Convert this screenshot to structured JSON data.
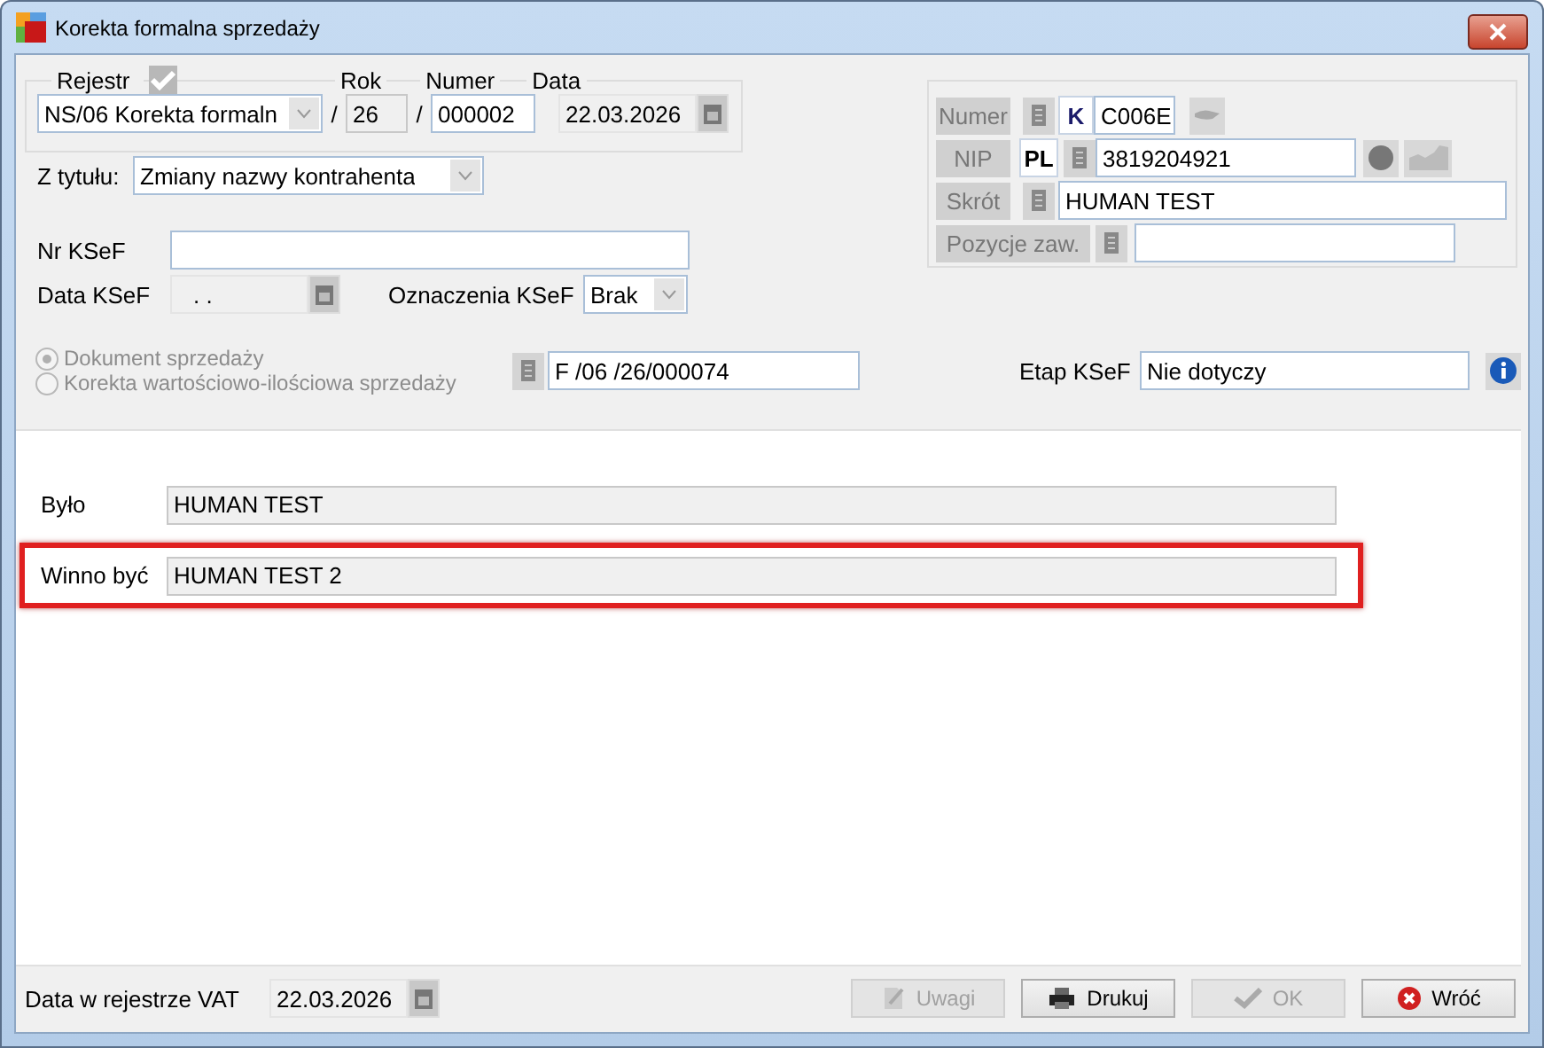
{
  "window": {
    "title": "Korekta formalna sprzedaży"
  },
  "header": {
    "rejestr": {
      "label": "Rejestr",
      "checked": true,
      "value": "NS/06 Korekta formaln"
    },
    "separator": "/",
    "rok": {
      "label": "Rok",
      "value": "26"
    },
    "numer": {
      "label": "Numer",
      "value": "000002"
    },
    "data": {
      "label": "Data",
      "value": "22.03.2026"
    }
  },
  "z_tytulu": {
    "label": "Z tytułu:",
    "value": "Zmiany nazwy kontrahenta"
  },
  "nr_ksef": {
    "label": "Nr KSeF"
  },
  "data_ksef": {
    "label": "Data KSeF",
    "value": ". ."
  },
  "oznaczenia_ksef": {
    "label": "Oznaczenia KSeF",
    "value": "Brak"
  },
  "document_types": [
    {
      "label": "Dokument sprzedaży",
      "selected": true,
      "disabled": true
    },
    {
      "label": "Korekta wartościowo-ilościowa sprzedaży",
      "selected": false,
      "disabled": true
    }
  ],
  "source_document": "F /06 /26/000074",
  "etap_ksef": {
    "label": "Etap KSeF",
    "value": "Nie dotyczy"
  },
  "contractor": {
    "numer": {
      "label": "Numer",
      "type": "K",
      "value": "C006E"
    },
    "nip": {
      "label": "NIP",
      "country": "PL",
      "value": "3819204921"
    },
    "skrot": {
      "label": "Skrót",
      "value": "HUMAN TEST"
    },
    "pozycje": {
      "label": "Pozycje zaw."
    }
  },
  "correction": [
    {
      "label": "Było",
      "value": "HUMAN TEST",
      "highlighted": false
    },
    {
      "label": "Winno być",
      "value": "HUMAN TEST 2",
      "highlighted": true
    }
  ],
  "footer": {
    "vat_date": {
      "label": "Data w rejestrze VAT",
      "value": "22.03.2026"
    },
    "buttons": [
      {
        "label": "Uwagi",
        "kind": "note",
        "disabled": true
      },
      {
        "label": "Drukuj",
        "kind": "print",
        "disabled": false
      },
      {
        "label": "OK",
        "kind": "ok",
        "disabled": true
      },
      {
        "label": "Wróć",
        "kind": "back",
        "disabled": false
      }
    ]
  }
}
